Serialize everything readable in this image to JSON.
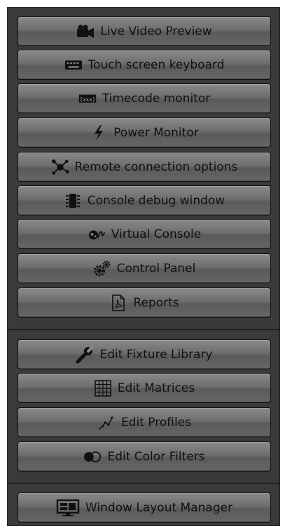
{
  "menu": {
    "group1": [
      {
        "id": "live-video-preview",
        "label": "Live Video Preview",
        "icon": "video-camera-icon"
      },
      {
        "id": "touch-screen-keyboard",
        "label": "Touch screen keyboard",
        "icon": "keyboard-icon"
      },
      {
        "id": "timecode-monitor",
        "label": "Timecode monitor",
        "icon": "timecode-icon"
      },
      {
        "id": "power-monitor",
        "label": "Power Monitor",
        "icon": "lightning-icon"
      },
      {
        "id": "remote-connection-options",
        "label": "Remote connection options",
        "icon": "network-nodes-icon"
      },
      {
        "id": "console-debug-window",
        "label": "Console debug window",
        "icon": "chip-icon"
      },
      {
        "id": "virtual-console",
        "label": "Virtual Console",
        "icon": "virtual-console-icon"
      },
      {
        "id": "control-panel",
        "label": "Control Panel",
        "icon": "gears-icon"
      },
      {
        "id": "reports",
        "label": "Reports",
        "icon": "pdf-document-icon"
      }
    ],
    "group2": [
      {
        "id": "edit-fixture-library",
        "label": "Edit Fixture Library",
        "icon": "wrench-icon"
      },
      {
        "id": "edit-matrices",
        "label": "Edit Matrices",
        "icon": "grid-icon"
      },
      {
        "id": "edit-profiles",
        "label": "Edit Profiles",
        "icon": "profile-curve-icon"
      },
      {
        "id": "edit-color-filters",
        "label": "Edit Color Filters",
        "icon": "color-filter-icon"
      }
    ],
    "group3": [
      {
        "id": "window-layout-manager",
        "label": "Window Layout Manager",
        "icon": "layout-monitor-icon"
      }
    ]
  },
  "colors": {
    "panel_bg": "#3a3a3a",
    "button_text": "#111111"
  }
}
